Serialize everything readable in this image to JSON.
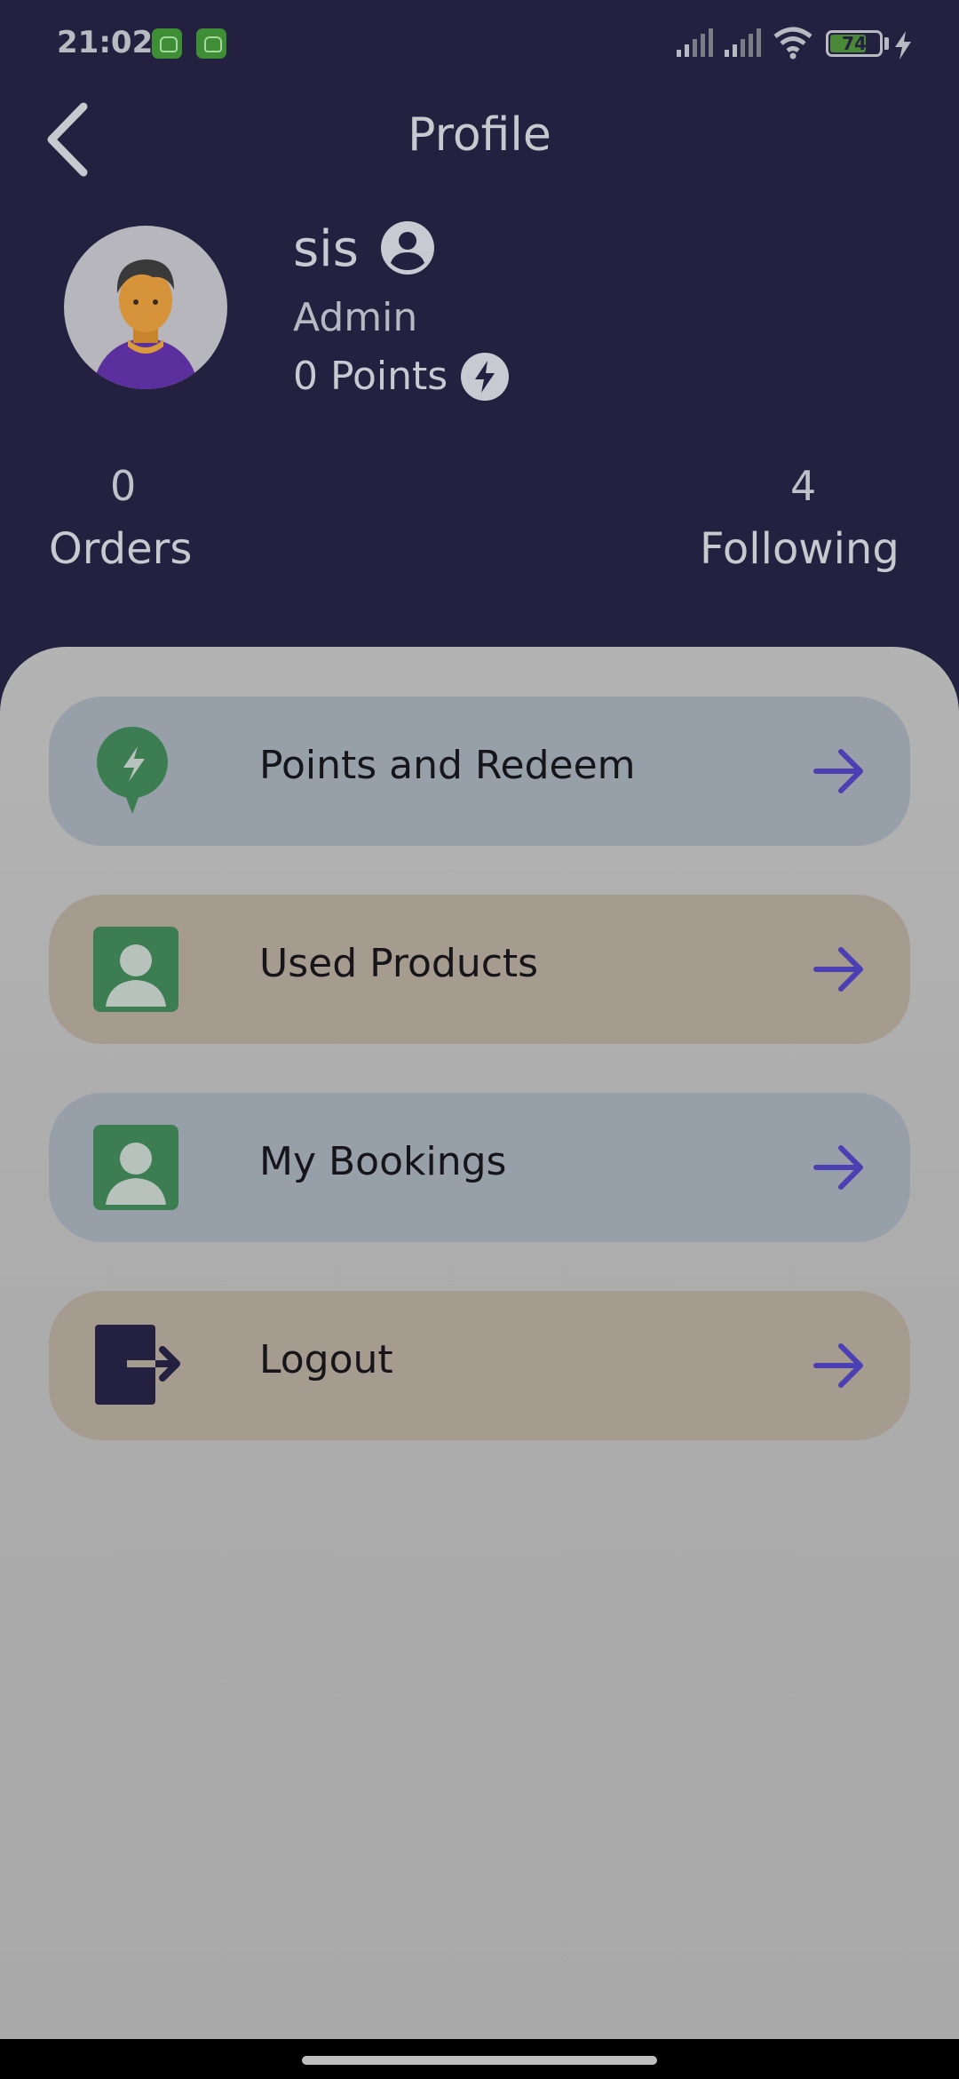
{
  "status_bar": {
    "time": "21:02",
    "battery": "74",
    "battery_level": 0.74,
    "icons": [
      "notification-icon",
      "notification-icon",
      "signal-icon",
      "signal-icon",
      "wifi-icon",
      "battery-icon",
      "charging-icon"
    ]
  },
  "header": {
    "title": "Profile",
    "back_icon": "back-chevron-icon"
  },
  "profile": {
    "name": "sis",
    "role": "Admin",
    "points": "0 Points",
    "avatar_icon": "avatar",
    "name_icon": "account-circle-icon",
    "points_icon": "lightning-icon"
  },
  "stats": {
    "orders_count": "0",
    "orders_label": "Orders",
    "following_count": "4",
    "following_label": "Following"
  },
  "menu": [
    {
      "label": "Points and Redeem",
      "icon": "lightning-bubble-icon",
      "color": "#97a0a9"
    },
    {
      "label": "Used Products",
      "icon": "person-card-icon",
      "color": "#a69b8f"
    },
    {
      "label": "My Bookings",
      "icon": "person-card-icon",
      "color": "#97a0a9"
    },
    {
      "label": "Logout",
      "icon": "logout-icon",
      "color": "#a69b8f"
    }
  ],
  "colors": {
    "header_bg": "#232040",
    "accent_arrow": "#4a3fb3",
    "icon_green": "#3d7d52"
  }
}
